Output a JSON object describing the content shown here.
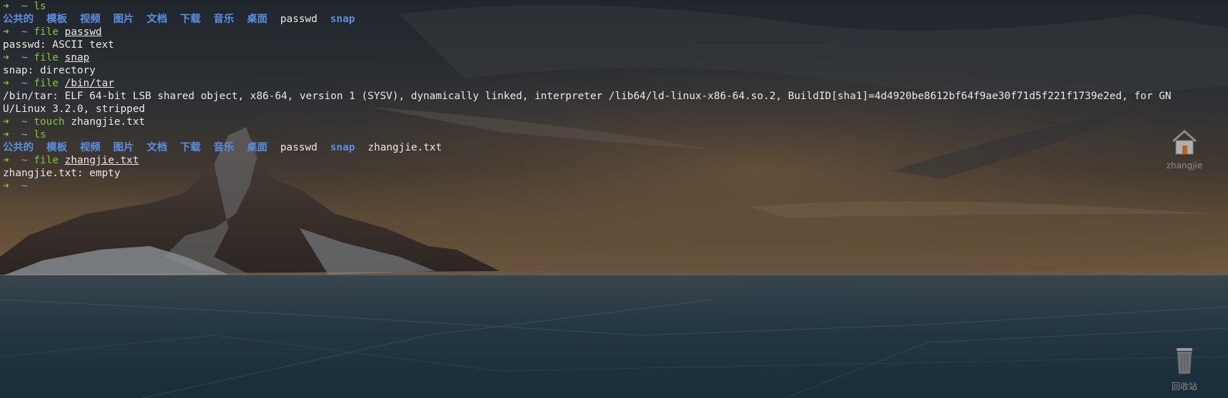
{
  "prompt": {
    "arrow": "➜",
    "dir": "~"
  },
  "terminal_lines": [
    {
      "kind": "cmd",
      "command": "ls",
      "arg": "",
      "arg_underlined": false
    },
    {
      "kind": "ls",
      "entries": [
        {
          "name": "公共的",
          "type": "dir"
        },
        {
          "name": "模板",
          "type": "dir"
        },
        {
          "name": "视频",
          "type": "dir"
        },
        {
          "name": "图片",
          "type": "dir"
        },
        {
          "name": "文档",
          "type": "dir"
        },
        {
          "name": "下载",
          "type": "dir"
        },
        {
          "name": "音乐",
          "type": "dir"
        },
        {
          "name": "桌面",
          "type": "dir"
        },
        {
          "name": "passwd",
          "type": "file"
        },
        {
          "name": "snap",
          "type": "dir"
        }
      ]
    },
    {
      "kind": "cmd",
      "command": "file",
      "arg": "passwd",
      "arg_underlined": true
    },
    {
      "kind": "out",
      "text": "passwd: ASCII text"
    },
    {
      "kind": "cmd",
      "command": "file",
      "arg": "snap",
      "arg_underlined": true
    },
    {
      "kind": "out",
      "text": "snap: directory"
    },
    {
      "kind": "cmd",
      "command": "file",
      "arg": "/bin/tar",
      "arg_underlined": true
    },
    {
      "kind": "out",
      "text": "/bin/tar: ELF 64-bit LSB shared object, x86-64, version 1 (SYSV), dynamically linked, interpreter /lib64/ld-linux-x86-64.so.2, BuildID[sha1]=4d4920be8612bf64f9ae30f71d5f221f1739e2ed, for GN"
    },
    {
      "kind": "out",
      "text": "U/Linux 3.2.0, stripped"
    },
    {
      "kind": "cmd",
      "command": "touch",
      "arg": "zhangjie.txt",
      "arg_underlined": false
    },
    {
      "kind": "cmd",
      "command": "ls",
      "arg": "",
      "arg_underlined": false
    },
    {
      "kind": "ls",
      "entries": [
        {
          "name": "公共的",
          "type": "dir"
        },
        {
          "name": "模板",
          "type": "dir"
        },
        {
          "name": "视频",
          "type": "dir"
        },
        {
          "name": "图片",
          "type": "dir"
        },
        {
          "name": "文档",
          "type": "dir"
        },
        {
          "name": "下载",
          "type": "dir"
        },
        {
          "name": "音乐",
          "type": "dir"
        },
        {
          "name": "桌面",
          "type": "dir"
        },
        {
          "name": "passwd",
          "type": "file"
        },
        {
          "name": "snap",
          "type": "dir"
        },
        {
          "name": "zhangjie.txt",
          "type": "file"
        }
      ]
    },
    {
      "kind": "cmd",
      "command": "file",
      "arg": "zhangjie.txt",
      "arg_underlined": true
    },
    {
      "kind": "out",
      "text": "zhangjie.txt: empty"
    },
    {
      "kind": "cmd",
      "command": "",
      "arg": "",
      "arg_underlined": false
    }
  ],
  "desktop_icons": {
    "home": {
      "label": "zhangjie",
      "icon": "home-folder-icon"
    },
    "trash": {
      "label": "回收站",
      "icon": "trash-icon"
    }
  },
  "colors": {
    "prompt_arrow": "#7ec832",
    "prompt_dir": "#5fb8d6",
    "command": "#7ec832",
    "directory": "#5a8fe6",
    "text": "#e8e8e8"
  }
}
